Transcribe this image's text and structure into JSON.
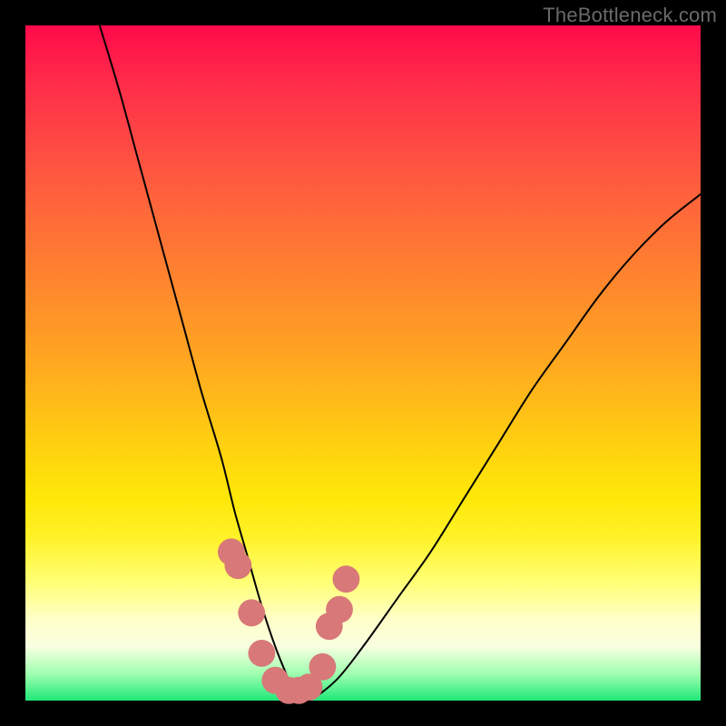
{
  "watermark": "TheBottleneck.com",
  "chart_data": {
    "type": "line",
    "title": "",
    "xlabel": "",
    "ylabel": "",
    "xlim": [
      0,
      100
    ],
    "ylim": [
      0,
      100
    ],
    "grid": false,
    "legend": false,
    "background_gradient": {
      "direction": "vertical",
      "stops": [
        {
          "pos": 0.0,
          "color": "#ff0a4a"
        },
        {
          "pos": 0.22,
          "color": "#ff5840"
        },
        {
          "pos": 0.5,
          "color": "#ffa820"
        },
        {
          "pos": 0.76,
          "color": "#fff22a"
        },
        {
          "pos": 0.92,
          "color": "#f8ffe0"
        },
        {
          "pos": 1.0,
          "color": "#20e878"
        }
      ]
    },
    "series": [
      {
        "name": "bottleneck-curve",
        "type": "line",
        "color": "#000000",
        "x": [
          11,
          14,
          17,
          20,
          23,
          26,
          29,
          31,
          33,
          35,
          37,
          39,
          40,
          42,
          46,
          50,
          55,
          60,
          65,
          70,
          75,
          80,
          85,
          90,
          95,
          100
        ],
        "y": [
          100,
          90,
          79,
          68,
          57,
          46,
          36,
          28,
          21,
          14,
          8,
          3,
          0,
          0,
          3,
          8,
          15,
          22,
          30,
          38,
          46,
          53,
          60,
          66,
          71,
          75
        ]
      },
      {
        "name": "sweet-spot-markers",
        "type": "scatter",
        "color": "#d87878",
        "x": [
          30.5,
          31.5,
          33.5,
          35.0,
          37.0,
          39.0,
          40.5,
          42.0,
          44.0,
          45.0,
          46.5,
          47.5
        ],
        "y": [
          22.0,
          20.0,
          13.0,
          7.0,
          3.0,
          1.5,
          1.5,
          2.0,
          5.0,
          11.0,
          13.5,
          18.0
        ],
        "marker_radius": 2.0
      }
    ]
  }
}
